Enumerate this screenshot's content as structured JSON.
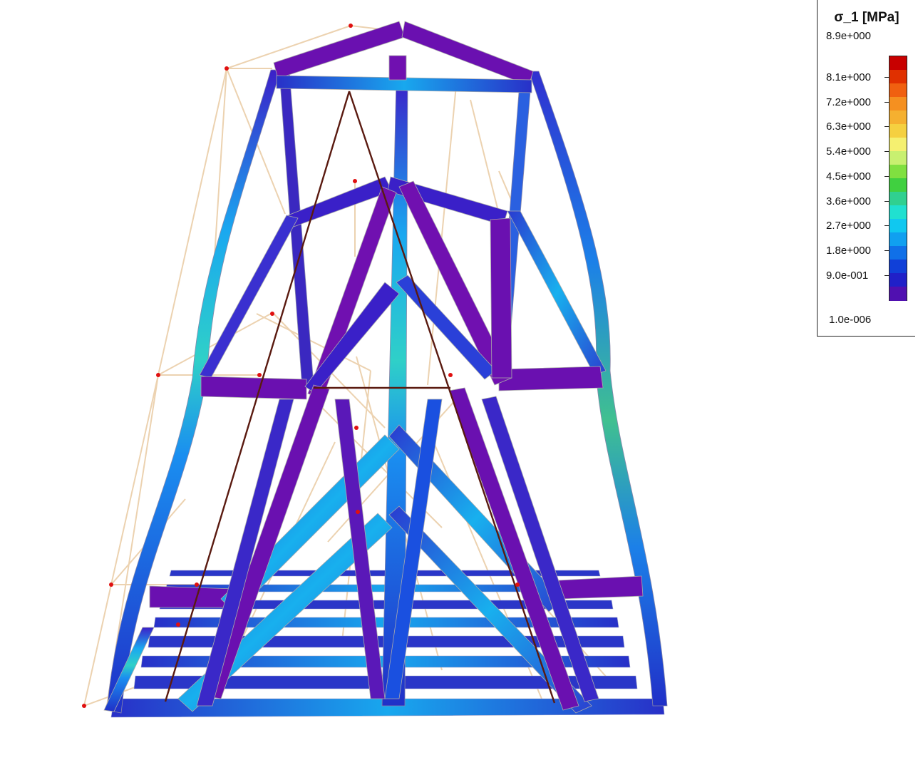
{
  "legend": {
    "title": "σ_1 [MPa]",
    "max_label": "8.9e+000",
    "min_label": "1.0e-006",
    "ticks": [
      "8.1e+000",
      "7.2e+000",
      "6.3e+000",
      "5.4e+000",
      "4.5e+000",
      "3.6e+000",
      "2.7e+000",
      "1.8e+000",
      "9.0e-001"
    ],
    "colors": [
      "#c80000",
      "#e03000",
      "#f06010",
      "#f59020",
      "#f5b030",
      "#f5d040",
      "#f5f070",
      "#c8f070",
      "#80e040",
      "#40d040",
      "#30d090",
      "#20e0d0",
      "#10c8f0",
      "#10a0f0",
      "#1070e8",
      "#1040d8",
      "#2020c8",
      "#5010b0"
    ]
  },
  "colors": {
    "background": "#ffffff",
    "deformed_frame": "#ecd2b0",
    "tie_rod": "#5a1a10",
    "support_node": "#e01010",
    "mesh_line": "#b0b0b0"
  }
}
